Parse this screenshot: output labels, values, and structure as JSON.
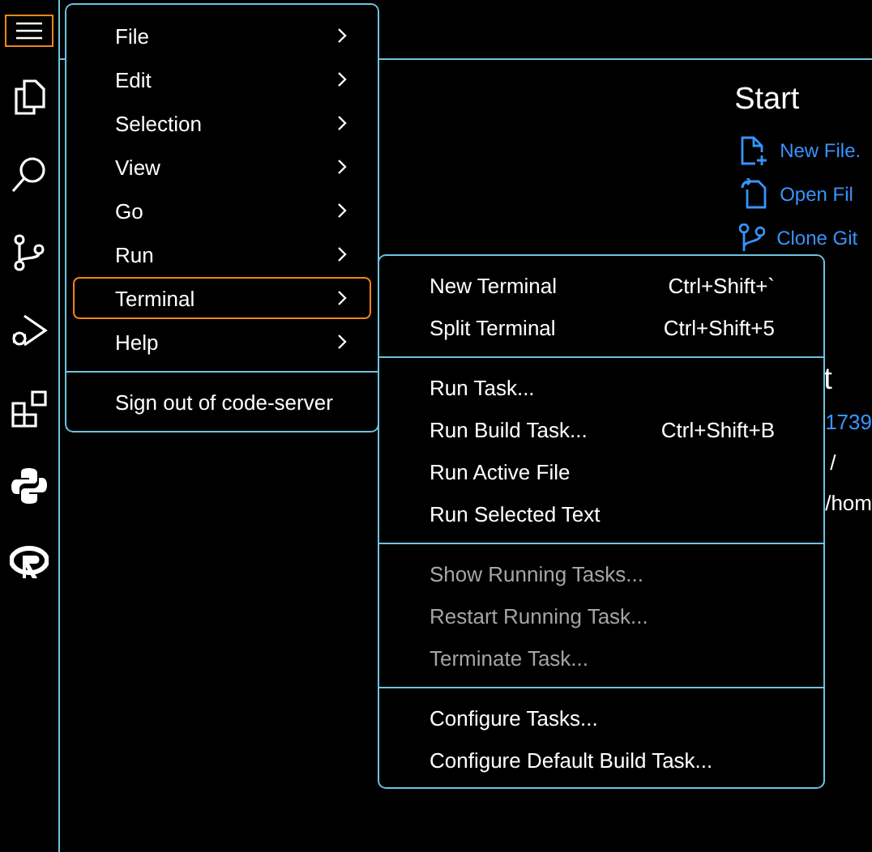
{
  "menu": {
    "items": [
      {
        "label": "File",
        "selected": false
      },
      {
        "label": "Edit",
        "selected": false
      },
      {
        "label": "Selection",
        "selected": false
      },
      {
        "label": "View",
        "selected": false
      },
      {
        "label": "Go",
        "selected": false
      },
      {
        "label": "Run",
        "selected": false
      },
      {
        "label": "Terminal",
        "selected": true
      },
      {
        "label": "Help",
        "selected": false
      }
    ],
    "sign_out": "Sign out of code-server"
  },
  "submenu": {
    "groups": [
      [
        {
          "label": "New Terminal",
          "shortcut": "Ctrl+Shift+`",
          "disabled": false
        },
        {
          "label": "Split Terminal",
          "shortcut": "Ctrl+Shift+5",
          "disabled": false
        }
      ],
      [
        {
          "label": "Run Task...",
          "disabled": false
        },
        {
          "label": "Run Build Task...",
          "shortcut": "Ctrl+Shift+B",
          "disabled": false
        },
        {
          "label": "Run Active File",
          "disabled": false
        },
        {
          "label": "Run Selected Text",
          "disabled": false
        }
      ],
      [
        {
          "label": "Show Running Tasks...",
          "disabled": true
        },
        {
          "label": "Restart Running Task...",
          "disabled": true
        },
        {
          "label": "Terminate Task...",
          "disabled": true
        }
      ],
      [
        {
          "label": "Configure Tasks...",
          "disabled": false
        },
        {
          "label": "Configure Default Build Task...",
          "disabled": false
        }
      ]
    ]
  },
  "welcome": {
    "start": {
      "heading": "Start",
      "links": [
        {
          "label": "New File."
        },
        {
          "label": "Open Fil"
        },
        {
          "label": "Clone Git"
        }
      ]
    },
    "recent": {
      "heading": "t",
      "items": [
        {
          "label": "1739",
          "kind": "link"
        },
        {
          "label": "/",
          "kind": "path"
        },
        {
          "label": "/hom",
          "kind": "path"
        }
      ]
    }
  }
}
